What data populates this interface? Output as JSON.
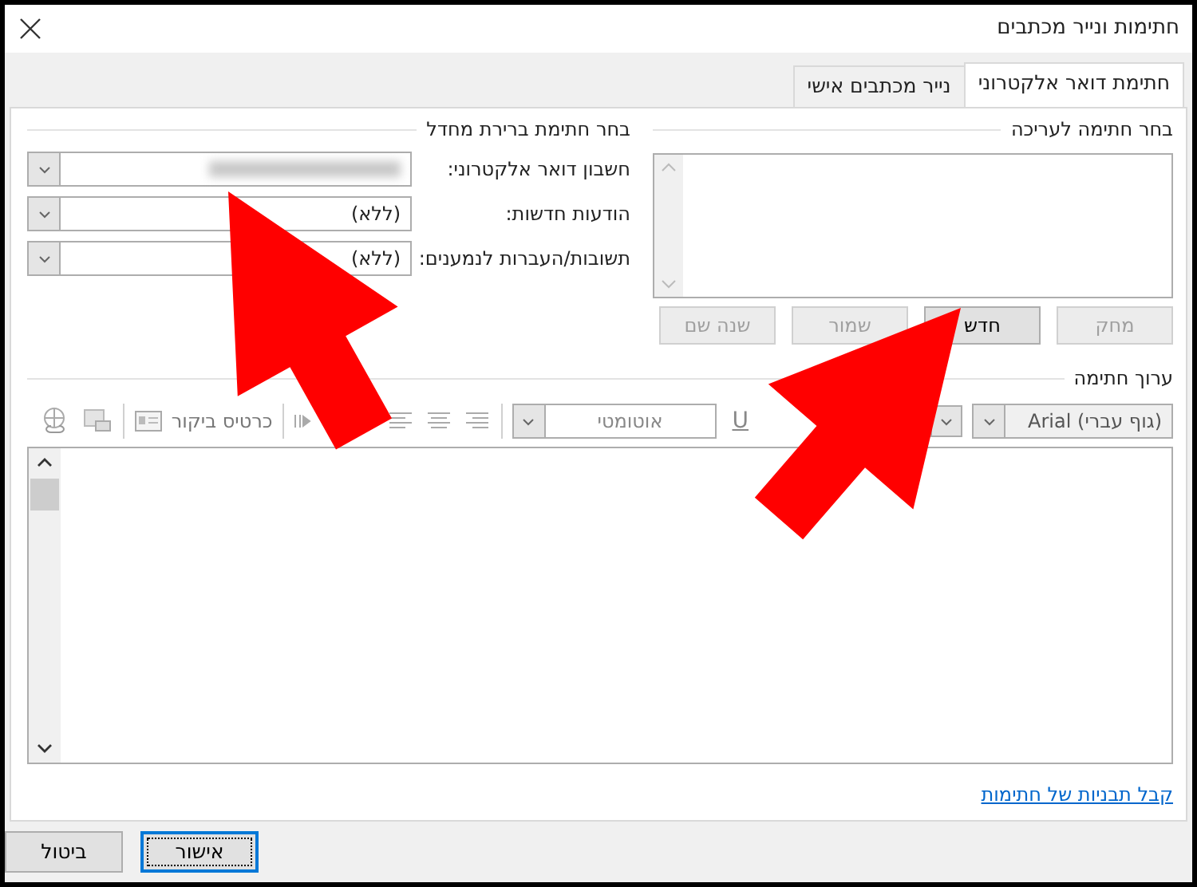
{
  "window": {
    "title": "חתימות ונייר מכתבים"
  },
  "tabs": [
    {
      "label": "חתימת דואר אלקטרוני",
      "selected": true
    },
    {
      "label": "נייר מכתבים אישי",
      "selected": false
    }
  ],
  "edit_section": {
    "title": "בחר חתימה לעריכה",
    "buttons": [
      {
        "label": "מחק",
        "disabled": true
      },
      {
        "label": "חדש",
        "disabled": false
      },
      {
        "label": "שמור",
        "disabled": true
      },
      {
        "label": "שנה שם",
        "disabled": true
      }
    ]
  },
  "default_section": {
    "title": "בחר חתימת ברירת מחדל",
    "fields": [
      {
        "label": "חשבון דואר אלקטרוני:",
        "redacted": true
      },
      {
        "label": "הודעות חדשות:",
        "value": "(ללא)"
      },
      {
        "label": "תשובות/העברות לנמענים:",
        "value": "(ללא)"
      }
    ]
  },
  "editor": {
    "title": "ערוך חתימה",
    "font": "Arial (גוף עברי)",
    "color_name": "אוטומטי",
    "underline": "U",
    "business_card": "כרטיס ביקור"
  },
  "templates_link": "קבל תבניות של חתימות",
  "dialog_buttons": [
    {
      "label": "אישור",
      "default": true
    },
    {
      "label": "ביטול",
      "default": false
    }
  ]
}
